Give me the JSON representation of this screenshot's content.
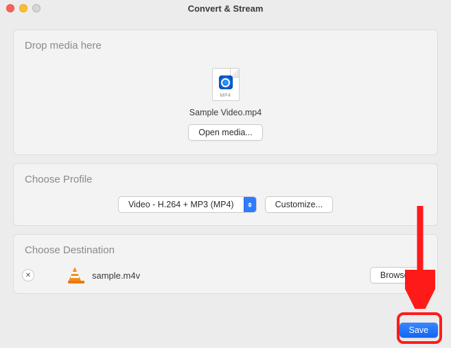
{
  "window": {
    "title": "Convert & Stream"
  },
  "drop": {
    "title": "Drop media here",
    "file_ext": "MP4",
    "file_name": "Sample Video.mp4",
    "open_label": "Open media..."
  },
  "profile": {
    "title": "Choose Profile",
    "selected": "Video - H.264 + MP3 (MP4)",
    "customize_label": "Customize..."
  },
  "destination": {
    "title": "Choose Destination",
    "file_name": "sample.m4v",
    "browse_label": "Browse..."
  },
  "footer": {
    "save_label": "Save"
  }
}
